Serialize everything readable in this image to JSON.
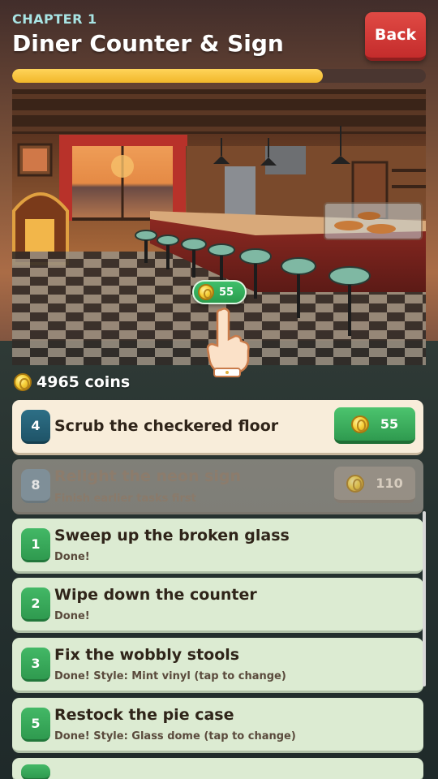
{
  "header": {
    "chapter": "CHAPTER 1",
    "title": "Diner Counter & Sign",
    "back_label": "Back"
  },
  "progress": {
    "fraction": 0.75
  },
  "scene": {
    "bubble_value": "55",
    "hand_icon": "pointing-hand-icon"
  },
  "wallet": {
    "coins_text": "4965 coins",
    "icon": "coin-icon"
  },
  "tasks": [
    {
      "number": "4",
      "title": "Scrub the checkered floor",
      "subtitle": "",
      "reward": "55",
      "state": "current"
    },
    {
      "number": "8",
      "title": "Relight the neon sign",
      "subtitle": "Finish earlier tasks first",
      "reward": "110",
      "state": "locked"
    },
    {
      "number": "1",
      "title": "Sweep up the broken glass",
      "subtitle": "Done!",
      "reward": "",
      "state": "done"
    },
    {
      "number": "2",
      "title": "Wipe down the counter",
      "subtitle": "Done!",
      "reward": "",
      "state": "done"
    },
    {
      "number": "3",
      "title": "Fix the wobbly stools",
      "subtitle": "Done! Style: Mint vinyl (tap to change)",
      "reward": "",
      "state": "done"
    },
    {
      "number": "5",
      "title": "Restock the pie case",
      "subtitle": "Done! Style: Glass dome (tap to change)",
      "reward": "",
      "state": "done"
    }
  ],
  "colors": {
    "accent_green": "#2f9a4f",
    "back_red": "#d43a36",
    "progress_yellow": "#f6c437",
    "current_teal": "#1f5468"
  }
}
